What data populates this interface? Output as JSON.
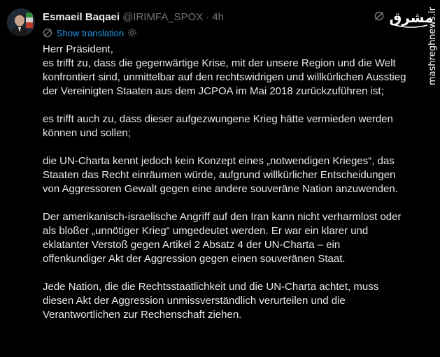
{
  "tweet": {
    "author_name": "Esmaeil Baqaei",
    "handle": "@IRIMFA_SPOX",
    "separator": "·",
    "time": "4h",
    "show_translation_label": "Show translation",
    "paragraphs": [
      "Herr Präsident,\nes trifft zu, dass die gegenwärtige Krise, mit der unsere Region und die Welt konfrontiert sind, unmittelbar auf den rechtswidrigen und willkürlichen Ausstieg der Vereinigten Staaten aus dem JCPOA im Mai 2018 zurückzuführen ist;",
      "es trifft auch zu, dass dieser aufgezwungene Krieg hätte vermieden werden können und sollen;",
      "die UN-Charta kennt jedoch kein Konzept eines „notwendigen Krieges“, das Staaten das Recht einräumen würde, aufgrund willkürlicher Entscheidungen von Aggressoren Gewalt gegen eine andere souveräne Nation anzuwenden.",
      "Der amerikanisch-israelische Angriff auf den Iran kann nicht verharmlost oder als bloßer „unnötiger Krieg“ umgedeutet werden. Er war ein klarer und eklatanter Verstoß gegen Artikel 2 Absatz 4 der UN-Charta – ein offenkundiger Akt der Aggression gegen einen souveränen Staat.",
      "Jede Nation, die die Rechtsstaatlichkeit und die UN-Charta achtet, muss diesen Akt der Aggression unmissverständlich verurteilen und die Verantwortlichen zur Rechenschaft ziehen."
    ]
  },
  "watermark": {
    "site": "mashreghnews.ir",
    "logo_text": "مشرق"
  },
  "icons": {
    "translate": "globe-icon",
    "settings": "gear-icon",
    "grok": "grok-icon"
  },
  "colors": {
    "background": "#000000",
    "text": "#e7e9ea",
    "muted": "#71767b",
    "link": "#1d9bf0"
  }
}
